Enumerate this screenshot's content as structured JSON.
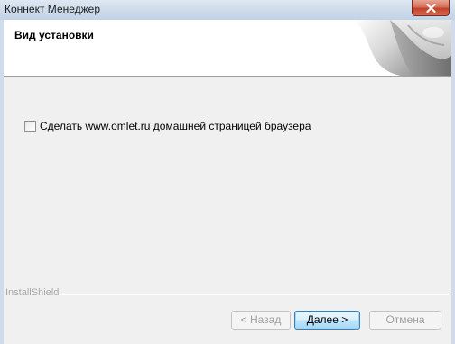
{
  "window": {
    "title": "Коннект Менеджер"
  },
  "banner": {
    "title": "Вид установки"
  },
  "options": {
    "homepage_checkbox_label": "Сделать www.omlet.ru домашней страницей браузера",
    "homepage_checked": false
  },
  "footer": {
    "brand": "InstallShield"
  },
  "buttons": {
    "back": "< Назад",
    "next": "Далее >",
    "cancel": "Отмена"
  },
  "colors": {
    "titlebar": "#cfdceb",
    "close_button": "#c2412a",
    "dialog_bg": "#f0f0f0",
    "default_button_border": "#3c7fb1"
  }
}
